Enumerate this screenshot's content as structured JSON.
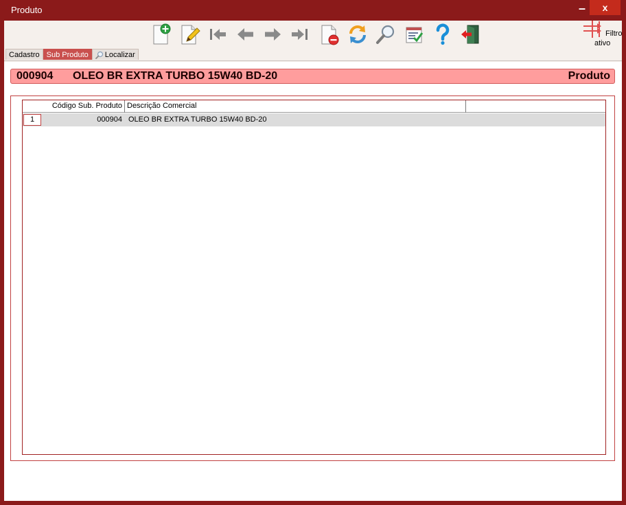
{
  "window": {
    "title": "Produto",
    "minimize_label": "–",
    "close_label": "x"
  },
  "toolbar": {
    "buttons": [
      {
        "name": "new-record-icon"
      },
      {
        "name": "edit-record-icon"
      },
      {
        "name": "first-record-icon"
      },
      {
        "name": "previous-record-icon"
      },
      {
        "name": "next-record-icon"
      },
      {
        "name": "last-record-icon"
      },
      {
        "name": "delete-record-icon"
      },
      {
        "name": "refresh-icon"
      },
      {
        "name": "search-icon"
      },
      {
        "name": "checklist-icon"
      },
      {
        "name": "help-icon"
      },
      {
        "name": "exit-icon"
      }
    ],
    "filter": {
      "line1": "Filtro",
      "line2": "ativo",
      "icon": "filter-icon"
    }
  },
  "tabs": [
    {
      "label": "Cadastro",
      "active": false
    },
    {
      "label": "Sub Produto",
      "active": true
    },
    {
      "label": "Localizar",
      "active": false,
      "icon": "magnifier-icon"
    }
  ],
  "header": {
    "code": "000904",
    "name": "OLEO BR EXTRA TURBO 15W40 BD-20",
    "section": "Produto"
  },
  "grid": {
    "columns": [
      "Código Sub. Produto",
      "Descrição Comercial",
      ""
    ],
    "rows": [
      {
        "index": "1",
        "code": "000904",
        "description": "OLEO BR EXTRA TURBO 15W40 BD-20"
      }
    ]
  },
  "colors": {
    "frame": "#8b1a1a",
    "close_button": "#c42b1c",
    "active_tab": "#c9504e",
    "banner": "#ff9d9d",
    "grid_border": "#a02020"
  }
}
